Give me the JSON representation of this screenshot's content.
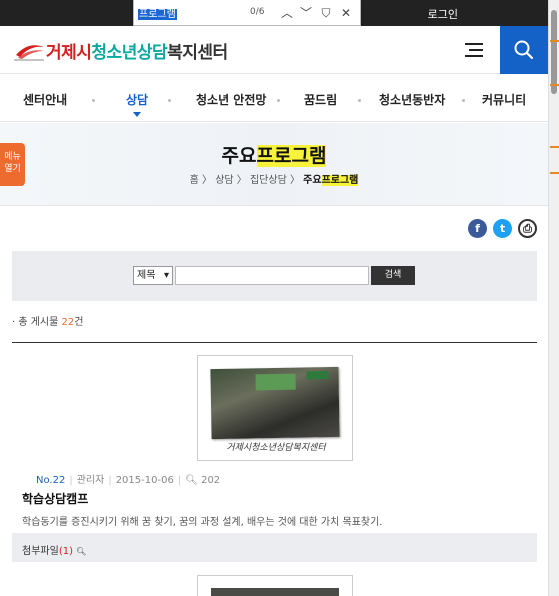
{
  "findbar": {
    "query": "프로그램",
    "count": "0/6",
    "up": "︿",
    "down": "﹀",
    "filter": "⛉",
    "close": "✕"
  },
  "topbar": {
    "login": "로그인"
  },
  "header": {
    "logo_r": "거제시",
    "logo_t": "청소년상담",
    "logo_g": "복지센터"
  },
  "nav": {
    "items": [
      "센터안내",
      "상담",
      "청소년 안전망",
      "꿈드림",
      "청소년동반자",
      "커뮤니티"
    ]
  },
  "menu_open": {
    "line1": "메뉴",
    "line2": "열기"
  },
  "page": {
    "title_a": "주요",
    "title_b": "프로그램"
  },
  "breadcrumb": {
    "home": "홈",
    "c1": "상담",
    "c2": "집단상담",
    "c3a": "주요",
    "c3b": "프로그램",
    "sep": "〉"
  },
  "share": {
    "facebook": "f",
    "twitter": "t",
    "print": "⎙"
  },
  "search": {
    "select": "제목",
    "button": "검색"
  },
  "total": {
    "prefix": "· 총 게시물 ",
    "count": "22",
    "suffix": "건"
  },
  "post": {
    "caption": "거제시청소년상담복지센터",
    "no": "No.22",
    "author": "관리자",
    "date": "2015-10-06",
    "views": "202",
    "title": "학습상담캠프",
    "desc": "학습동기를 증진시키기 위해 꿈 찾기, 꿈의 과정 설계, 배우는 것에 대한 가치 목표찾기.",
    "attach_label": "첨부파일",
    "attach_count": "(1)"
  },
  "colors": {
    "brand_blue": "#1461c8",
    "accent_orange": "#ee6b2f",
    "highlight": "#f7f33a"
  }
}
